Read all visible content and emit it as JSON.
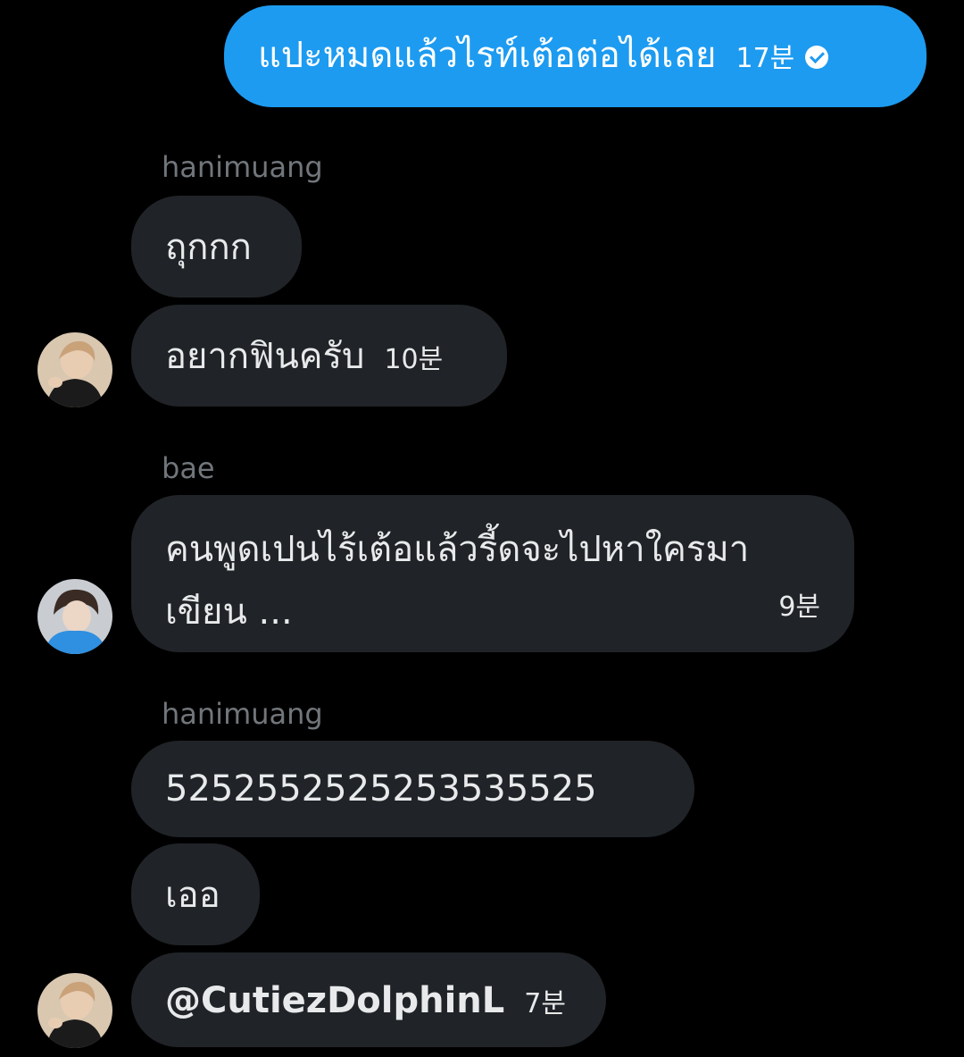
{
  "colors": {
    "background": "#000000",
    "outgoing_bubble": "#1d9bf0",
    "incoming_bubble": "#202327",
    "sender_name": "#71767b",
    "text": "#e7e9ea"
  },
  "messages": [
    {
      "direction": "outgoing",
      "text": "แปะหมดแล้วไรท์เต้อต่อได้เลย",
      "time": "17분",
      "read_icon": "check-circle-icon"
    },
    {
      "direction": "incoming",
      "sender": "hanimuang",
      "text": "ถุกกก"
    },
    {
      "direction": "incoming",
      "text": "อยากฟินครับ",
      "time": "10분",
      "avatar": "avatar-hanimuang"
    },
    {
      "direction": "incoming",
      "sender": "bae",
      "text_line1": "คนพูดเปนไร้เต้อแล้วรี้ดจะไปหาใครมา",
      "text_line2": "เขียน ...",
      "time": "9분",
      "avatar": "avatar-bae"
    },
    {
      "direction": "incoming",
      "sender": "hanimuang",
      "text": "5252552525253535525"
    },
    {
      "direction": "incoming",
      "text": "เออ"
    },
    {
      "direction": "incoming",
      "text": "@CutiezDolphinL",
      "time": "7분",
      "avatar": "avatar-hanimuang"
    }
  ]
}
